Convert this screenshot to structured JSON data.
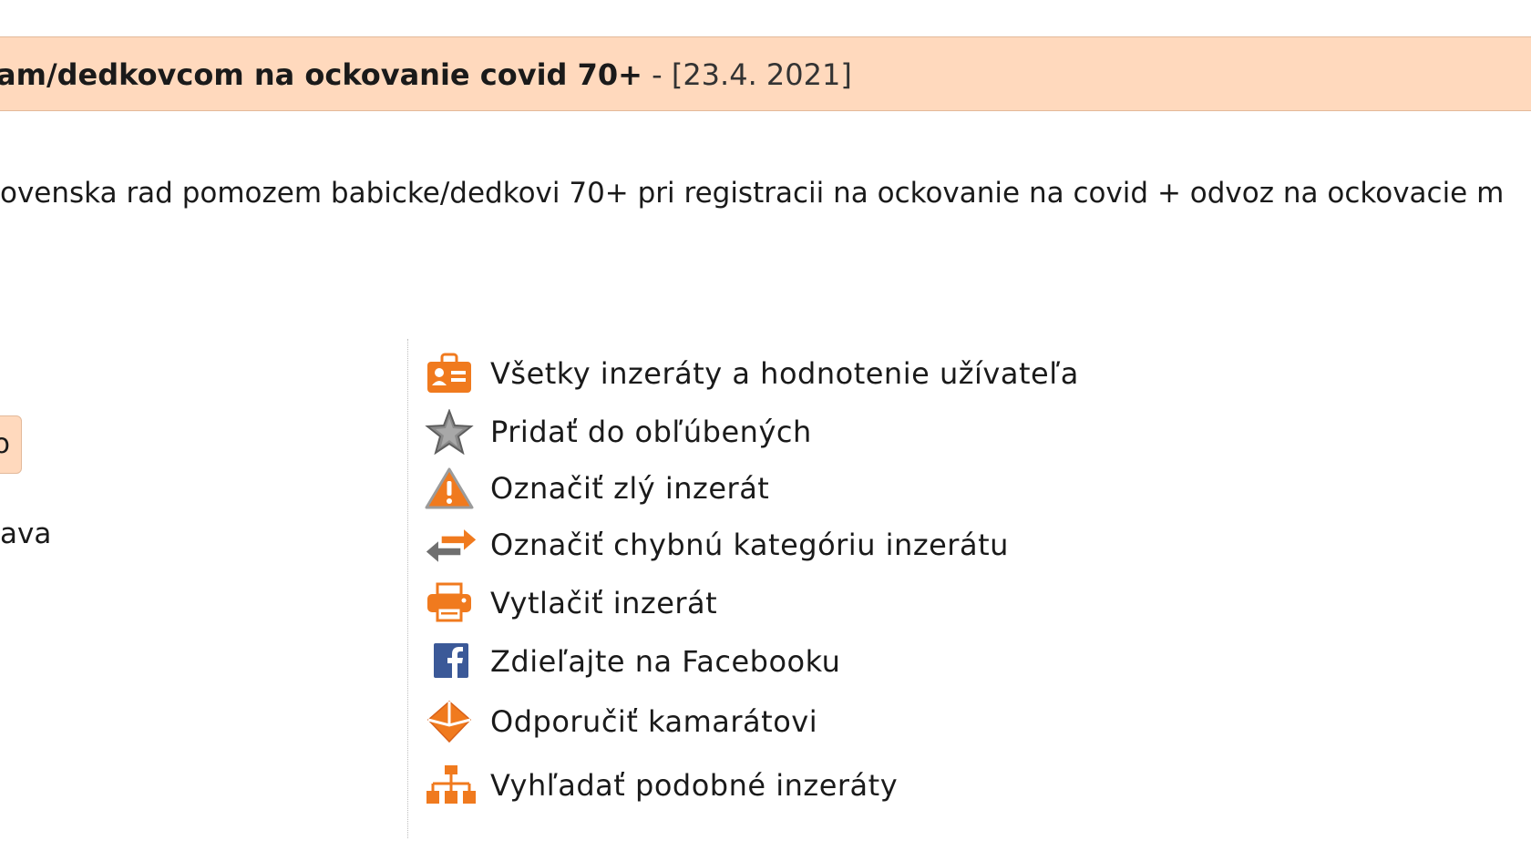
{
  "header": {
    "title": "am/dedkovcom na ockovanie covid 70+",
    "separator": " - ",
    "date": "[23.4. 2021]"
  },
  "content": {
    "description": "ovenska rad pomozem babicke/dedkovi 70+ pri registracii na ockovanie na covid + odvoz na ockovacie m"
  },
  "left": {
    "chip_label": "o",
    "location_fragment": "ava"
  },
  "actions": [
    {
      "icon": "user-card-icon",
      "label": "Všetky inzeráty a hodnotenie užívateľa"
    },
    {
      "icon": "star-icon",
      "label": "Pridať do obľúbených"
    },
    {
      "icon": "warning-icon",
      "label": "Označiť zlý inzerát"
    },
    {
      "icon": "swap-arrows-icon",
      "label": "Označiť chybnú kategóriu inzerátu"
    },
    {
      "icon": "printer-icon",
      "label": "Vytlačiť inzerát"
    },
    {
      "icon": "facebook-icon",
      "label": "Zdieľajte na Facebooku"
    },
    {
      "icon": "envelope-icon",
      "label": "Odporučiť kamarátovi"
    },
    {
      "icon": "hierarchy-icon",
      "label": "Vyhľadať podobné inzeráty"
    }
  ],
  "colors": {
    "title_bar_bg": "#ffd9bd",
    "icon_orange": "#f07a1e",
    "icon_grey": "#777777",
    "facebook_blue": "#3b5998"
  }
}
